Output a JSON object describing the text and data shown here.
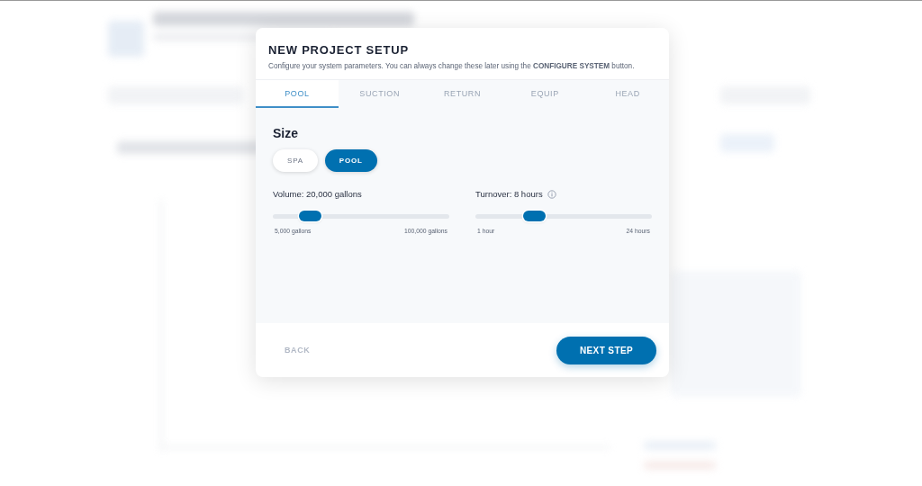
{
  "dialog": {
    "title": "NEW PROJECT SETUP",
    "description": "Configure your system parameters. You can always change these later using the **CONFIGURE SYSTEM** button.",
    "tabs": [
      {
        "label": "POOL",
        "selected": true
      },
      {
        "label": "SUCTION",
        "selected": false
      },
      {
        "label": "RETURN",
        "selected": false
      },
      {
        "label": "EQUIP",
        "selected": false
      },
      {
        "label": "HEAD",
        "selected": false
      }
    ],
    "section_title": "Size",
    "size_options": [
      {
        "label": "SPA",
        "selected": false
      },
      {
        "label": "POOL",
        "selected": true
      }
    ],
    "sliders": [
      {
        "label": "Volume: 20,000 gallons",
        "info": false,
        "level": 0.21,
        "min_label": "5,000 gallons",
        "max_label": "100,000 gallons"
      },
      {
        "label": "Turnover: 8 hours",
        "info": true,
        "level": 0.33,
        "min_label": "1 hour",
        "max_label": "24 hours"
      }
    ],
    "back_button": "BACK",
    "next_button": "NEXT STEP"
  }
}
